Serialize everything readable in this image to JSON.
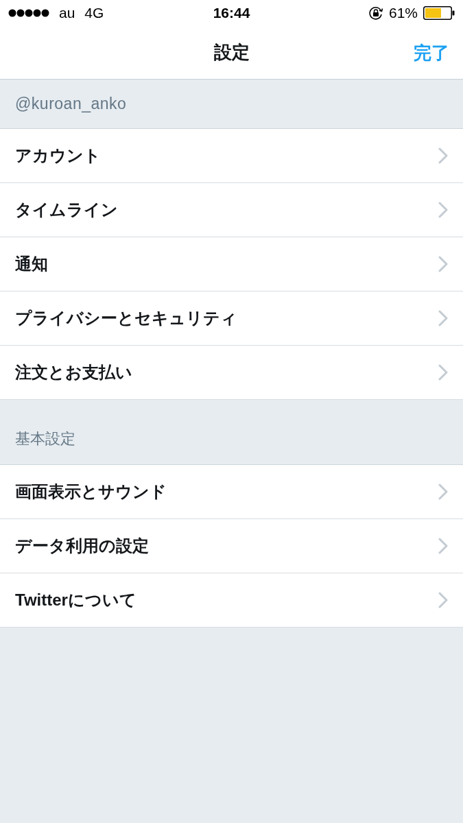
{
  "status_bar": {
    "carrier": "au",
    "network": "4G",
    "time": "16:44",
    "battery": "61%"
  },
  "nav_bar": {
    "title": "設定",
    "done_button": "完了"
  },
  "sections": [
    {
      "kind": "account",
      "header": "@kuroan_anko",
      "items": [
        "アカウント",
        "タイムライン",
        "通知",
        "プライバシーとセキュリティ",
        "注文とお支払い"
      ]
    },
    {
      "kind": "general",
      "header": "基本設定",
      "items": [
        "画面表示とサウンド",
        "データ利用の設定",
        "Twitterについて"
      ]
    }
  ]
}
